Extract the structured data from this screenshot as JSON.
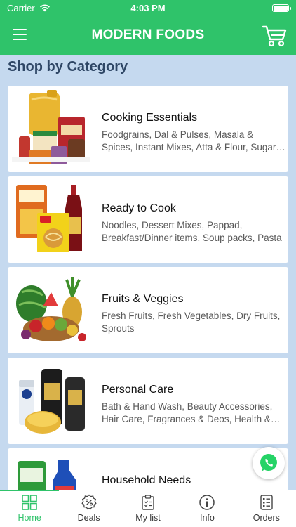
{
  "status": {
    "carrier": "Carrier",
    "time": "4:03 PM"
  },
  "header": {
    "title": "MODERN FOODS",
    "menu_icon": "hamburger-menu-icon",
    "cart_icon": "shopping-cart-icon"
  },
  "section_title": "Shop by Category",
  "categories": [
    {
      "title": "Cooking Essentials",
      "description": "Foodgrains, Dal & Pulses, Masala & Spices, Instant Mixes, Atta & Flour, Sugar & Salt"
    },
    {
      "title": "Ready to Cook",
      "description": "Noodles, Dessert Mixes, Pappad, Breakfast/Dinner items, Soup packs, Pasta"
    },
    {
      "title": "Fruits & Veggies",
      "description": "Fresh Fruits, Fresh Vegetables, Dry Fruits, Sprouts"
    },
    {
      "title": "Personal Care",
      "description": "Bath & Hand Wash, Beauty Accessories, Hair Care, Fragrances & Deos, Health & Hygiene"
    },
    {
      "title": "Household Needs",
      "description": ""
    }
  ],
  "tabs": [
    {
      "label": "Home",
      "icon": "grid-icon",
      "active": true
    },
    {
      "label": "Deals",
      "icon": "badge-percent-icon"
    },
    {
      "label": "My list",
      "icon": "clipboard-list-icon"
    },
    {
      "label": "Info",
      "icon": "info-icon"
    },
    {
      "label": "Orders",
      "icon": "orders-list-icon"
    }
  ],
  "colors": {
    "brand_green": "#2fc36a",
    "background": "#c5d9ef",
    "heading": "#2f4766"
  }
}
